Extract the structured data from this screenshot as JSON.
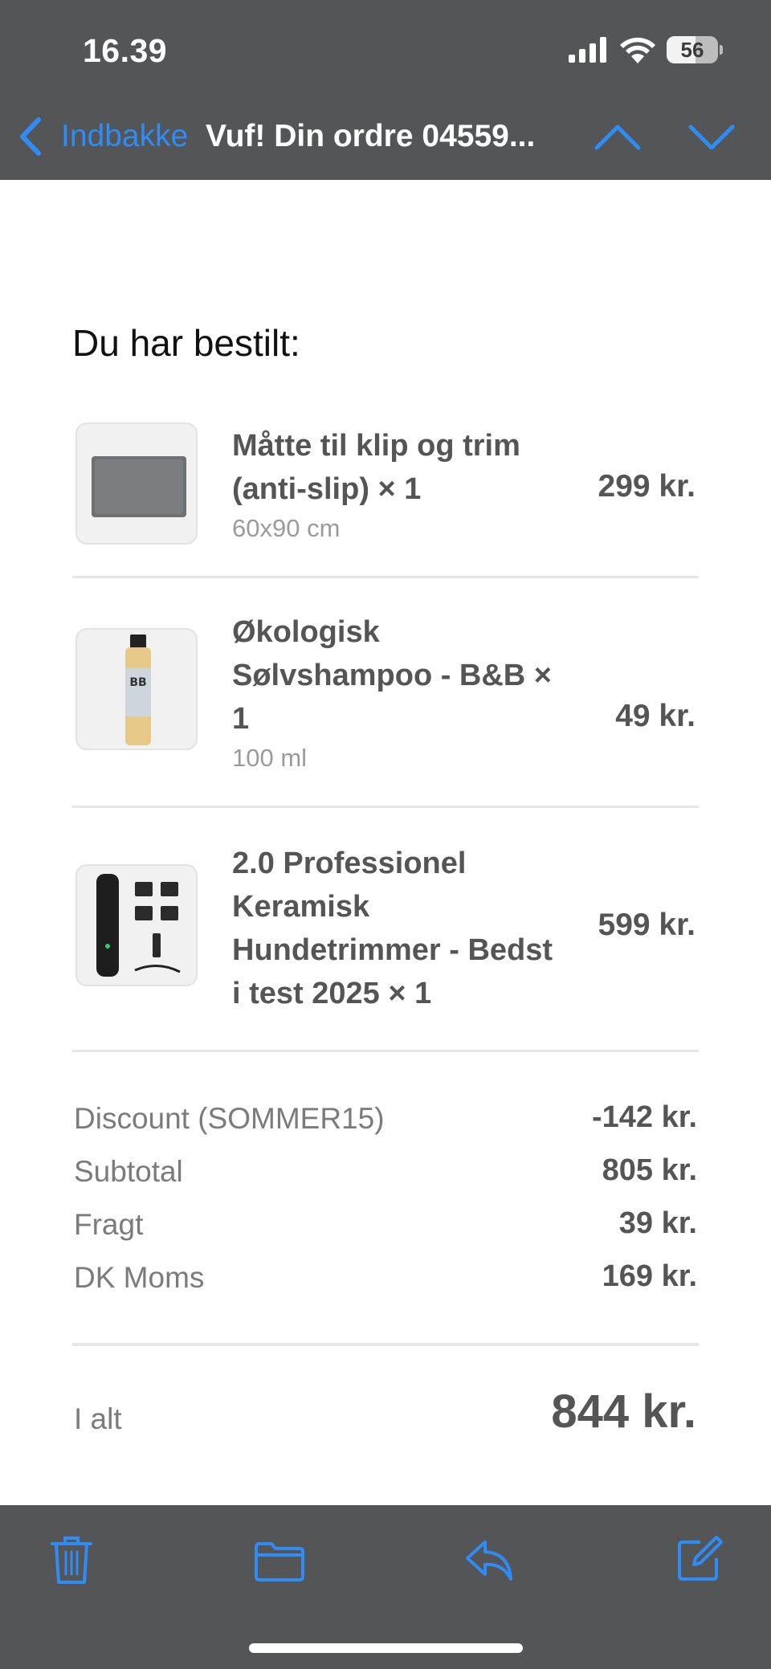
{
  "status": {
    "time": "16.39",
    "battery": "56"
  },
  "nav": {
    "back_label": "Indbakke",
    "title": "Vuf! Din ordre 04559..."
  },
  "order": {
    "heading": "Du har bestilt:",
    "items": [
      {
        "name": "Måtte til klip og trim (anti-slip) × 1",
        "variant": "60x90 cm",
        "price": "299 kr."
      },
      {
        "name": "Økologisk Sølvshampoo - B&B × 1",
        "variant": "100 ml",
        "price": "49 kr."
      },
      {
        "name": "2.0 Professionel Keramisk Hundetrimmer - Bedst i test 2025 × 1",
        "variant": "",
        "price": "599 kr."
      }
    ],
    "summary": [
      {
        "label": "Discount (SOMMER15)",
        "value": "-142 kr."
      },
      {
        "label": "Subtotal",
        "value": "805 kr."
      },
      {
        "label": "Fragt",
        "value": "39 kr."
      },
      {
        "label": "DK Moms",
        "value": "169 kr."
      }
    ],
    "total_label": "I alt",
    "total_value": "844 kr."
  },
  "toolbar": {
    "icons": [
      "trash-icon",
      "folder-icon",
      "reply-icon",
      "compose-icon"
    ]
  },
  "colors": {
    "accent": "#2f8cf5",
    "bar": "#545556"
  }
}
